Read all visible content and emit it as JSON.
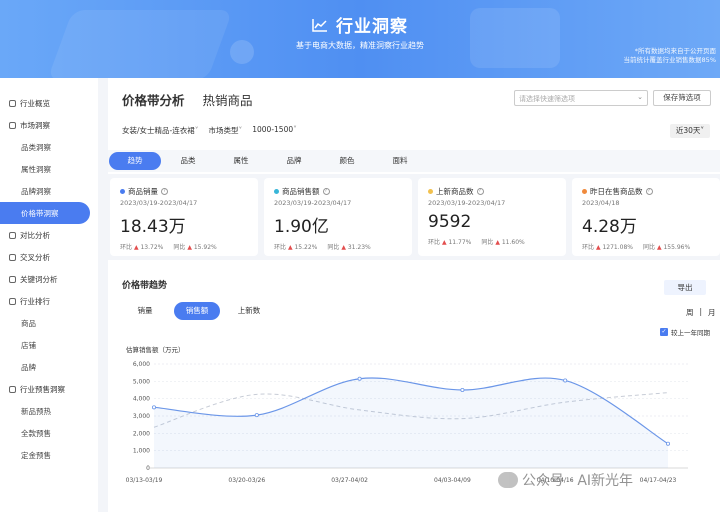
{
  "header": {
    "title": "行业洞察",
    "subtitle": "基于电商大数据，精准洞察行业趋势",
    "note_line1": "*所有数据均来自于公开页面",
    "note_line2": "当前统计覆盖行业销售数据85%"
  },
  "sidebar": {
    "items": [
      {
        "label": "行业概览",
        "sub": false,
        "active": false
      },
      {
        "label": "市场洞察",
        "sub": false,
        "active": false
      },
      {
        "label": "品类洞察",
        "sub": true,
        "active": false
      },
      {
        "label": "属性洞察",
        "sub": true,
        "active": false
      },
      {
        "label": "品牌洞察",
        "sub": true,
        "active": false
      },
      {
        "label": "价格带洞察",
        "sub": true,
        "active": true
      },
      {
        "label": "对比分析",
        "sub": false,
        "active": false
      },
      {
        "label": "交叉分析",
        "sub": false,
        "active": false
      },
      {
        "label": "关键词分析",
        "sub": false,
        "active": false
      },
      {
        "label": "行业排行",
        "sub": false,
        "active": false
      },
      {
        "label": "商品",
        "sub": true,
        "active": false
      },
      {
        "label": "店铺",
        "sub": true,
        "active": false
      },
      {
        "label": "品牌",
        "sub": true,
        "active": false
      },
      {
        "label": "行业预售洞察",
        "sub": false,
        "active": false
      },
      {
        "label": "新品预热",
        "sub": true,
        "active": false
      },
      {
        "label": "全款预售",
        "sub": true,
        "active": false
      },
      {
        "label": "定金预售",
        "sub": true,
        "active": false
      }
    ]
  },
  "main": {
    "tabs": [
      "价格带分析",
      "热销商品"
    ],
    "quick_select_placeholder": "请选择快速筛选项",
    "save_label": "保存筛选项",
    "filters": [
      "女装/女士精品-连衣裙",
      "市场类型",
      "1000-1500"
    ],
    "range_label": "近30天",
    "sub_tabs": [
      "趋势",
      "品类",
      "属性",
      "品牌",
      "颜色",
      "面料"
    ],
    "cards": [
      {
        "title": "商品销量",
        "date": "2023/03/19-2023/04/17",
        "value": "18.43万",
        "mom_label": "环比",
        "mom": "13.72%",
        "yoy_label": "同比",
        "yoy": "15.92%",
        "color": "#4a7cf0"
      },
      {
        "title": "商品销售额",
        "date": "2023/03/19-2023/04/17",
        "value": "1.90亿",
        "mom_label": "环比",
        "mom": "15.22%",
        "yoy_label": "同比",
        "yoy": "31.23%",
        "color": "#38b6d8"
      },
      {
        "title": "上新商品数",
        "date": "2023/03/19-2023/04/17",
        "value": "9592",
        "mom_label": "环比",
        "mom": "11.77%",
        "yoy_label": "同比",
        "yoy": "11.60%",
        "color": "#f2c14e"
      },
      {
        "title": "昨日在售商品数",
        "date": "2023/04/18",
        "value": "4.28万",
        "mom_label": "环比",
        "mom": "1271.08%",
        "yoy_label": "同比",
        "yoy": "155.96%",
        "color": "#f08a3c"
      }
    ],
    "trend_title": "价格带趋势",
    "export_label": "导出",
    "metric_tabs": [
      "销量",
      "销售额",
      "上新数"
    ],
    "period_week": "周",
    "period_month": "月",
    "compare_label": "较上一年同期"
  },
  "chart_data": {
    "type": "line",
    "ylabel": "估算销售额（万元）",
    "ylim": [
      0,
      6000
    ],
    "yticks": [
      "0",
      "1,000",
      "2,000",
      "3,000",
      "4,000",
      "5,000",
      "6,000"
    ],
    "categories": [
      "03/13-03/19",
      "03/20-03/26",
      "03/27-04/02",
      "04/03-04/09",
      "04/10-04/16",
      "04/17-04/23"
    ],
    "series": [
      {
        "values": [
          3500,
          3050,
          5150,
          4500,
          5050,
          1400
        ],
        "style": "solid",
        "color": "#6b96e8"
      },
      {
        "values": [
          2350,
          4250,
          3350,
          2850,
          3800,
          4350
        ],
        "style": "dashed",
        "color": "#c7ccd6"
      }
    ],
    "grid": true
  },
  "watermark": "公众号 · AI新光年"
}
